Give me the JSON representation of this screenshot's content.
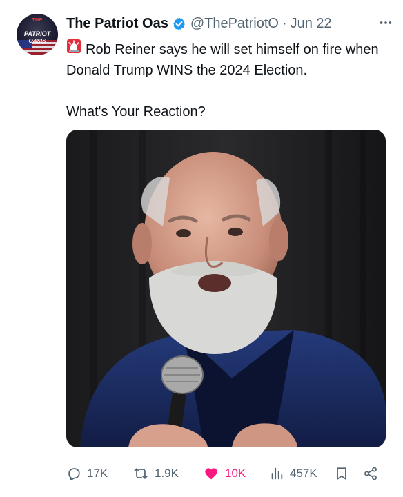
{
  "post": {
    "author": {
      "display_name": "The Patriot Oas",
      "handle": "@ThePatriotO",
      "verified": true,
      "avatar_text": {
        "top": "THE",
        "main": "PATRIOT",
        "sub": "OASIS"
      }
    },
    "separator": "·",
    "timestamp": "Jun 22",
    "text_line1": "Rob Reiner says he will set himself on fire when Donald Trump WINS the 2024 Election.",
    "text_line2": "What's Your Reaction?",
    "icons": {
      "siren": "siren-emoji",
      "more": "more-icon",
      "verified": "verified-badge-icon"
    },
    "media": {
      "kind": "photo"
    },
    "actions": {
      "replies": "17K",
      "reposts": "1.9K",
      "likes": "10K",
      "views": "457K"
    }
  },
  "colors": {
    "text": "#0f1419",
    "muted": "#536471",
    "verified": "#1d9bf0",
    "like": "#f91880"
  }
}
